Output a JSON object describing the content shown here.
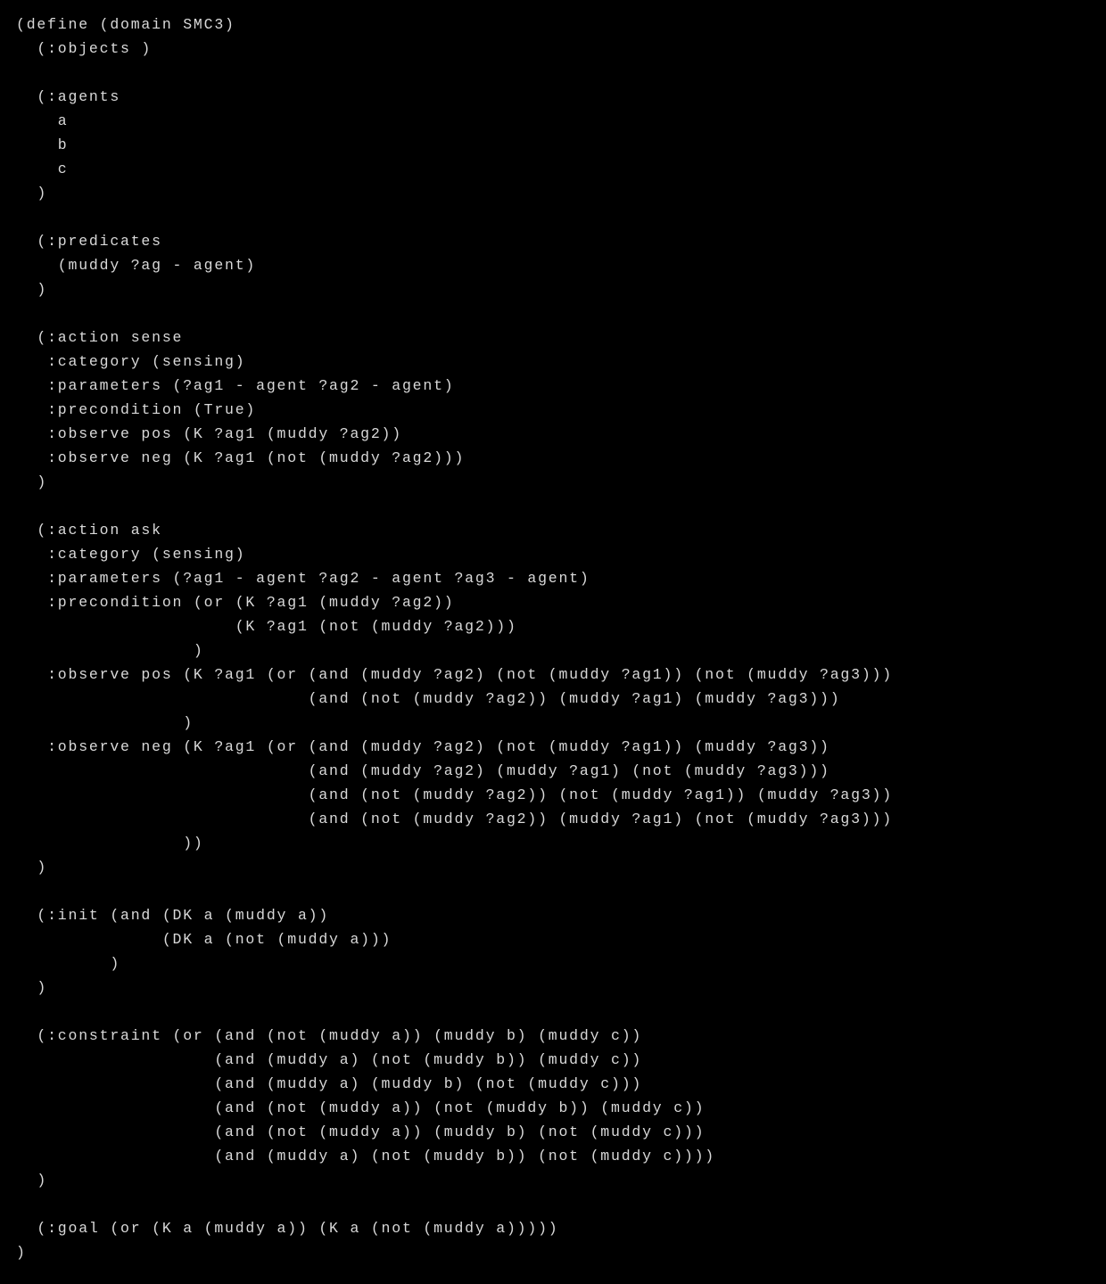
{
  "code": {
    "lines": [
      "(define (domain SMC3)",
      "  (:objects )",
      "",
      "  (:agents",
      "    a",
      "    b",
      "    c",
      "  )",
      "",
      "  (:predicates",
      "    (muddy ?ag - agent)",
      "  )",
      "",
      "  (:action sense",
      "   :category (sensing)",
      "   :parameters (?ag1 - agent ?ag2 - agent)",
      "   :precondition (True)",
      "   :observe pos (K ?ag1 (muddy ?ag2))",
      "   :observe neg (K ?ag1 (not (muddy ?ag2)))",
      "  )",
      "",
      "  (:action ask",
      "   :category (sensing)",
      "   :parameters (?ag1 - agent ?ag2 - agent ?ag3 - agent)",
      "   :precondition (or (K ?ag1 (muddy ?ag2))",
      "                     (K ?ag1 (not (muddy ?ag2)))",
      "                 )",
      "   :observe pos (K ?ag1 (or (and (muddy ?ag2) (not (muddy ?ag1)) (not (muddy ?ag3)))",
      "                            (and (not (muddy ?ag2)) (muddy ?ag1) (muddy ?ag3)))",
      "                )",
      "   :observe neg (K ?ag1 (or (and (muddy ?ag2) (not (muddy ?ag1)) (muddy ?ag3))",
      "                            (and (muddy ?ag2) (muddy ?ag1) (not (muddy ?ag3)))",
      "                            (and (not (muddy ?ag2)) (not (muddy ?ag1)) (muddy ?ag3))",
      "                            (and (not (muddy ?ag2)) (muddy ?ag1) (not (muddy ?ag3)))",
      "                ))",
      "  )",
      "",
      "  (:init (and (DK a (muddy a))",
      "              (DK a (not (muddy a)))",
      "         )",
      "  )",
      "",
      "  (:constraint (or (and (not (muddy a)) (muddy b) (muddy c))",
      "                   (and (muddy a) (not (muddy b)) (muddy c))",
      "                   (and (muddy a) (muddy b) (not (muddy c)))",
      "                   (and (not (muddy a)) (not (muddy b)) (muddy c))",
      "                   (and (not (muddy a)) (muddy b) (not (muddy c)))",
      "                   (and (muddy a) (not (muddy b)) (not (muddy c))))",
      "  )",
      "",
      "  (:goal (or (K a (muddy a)) (K a (not (muddy a)))))",
      ")"
    ]
  }
}
